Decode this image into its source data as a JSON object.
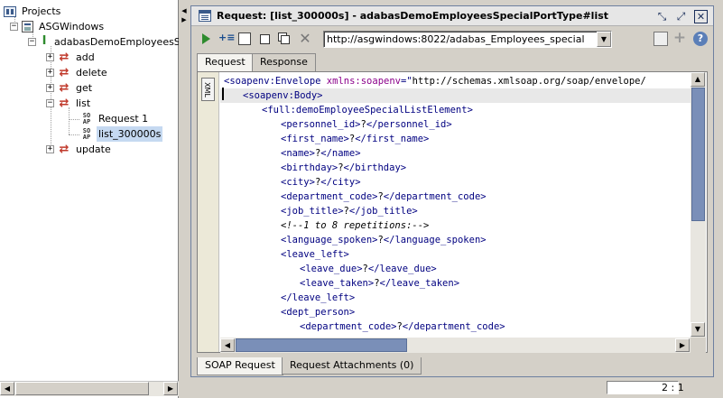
{
  "tree": {
    "root_label": "Projects",
    "project": "ASGWindows",
    "interface": "adabasDemoEmployeesSpe",
    "operations": [
      {
        "label": "add",
        "expanded": false
      },
      {
        "label": "delete",
        "expanded": false
      },
      {
        "label": "get",
        "expanded": false
      },
      {
        "label": "list",
        "expanded": true
      },
      {
        "label": "update",
        "expanded": false
      }
    ],
    "requests": [
      {
        "label": "Request 1",
        "selected": false
      },
      {
        "label": "list_300000s",
        "selected": true
      }
    ],
    "expander_plus": "+",
    "expander_minus": "−",
    "request_icon_text": "SO\nAP"
  },
  "window": {
    "title": "Request: [list_300000s] - adabasDemoEmployeesSpecialPortType#list",
    "restore_glyph": "⤡",
    "max_glyph": "⤢",
    "close_glyph": "✕"
  },
  "toolbar": {
    "endpoint_url": "http://asgwindows:8022/adabas_Employees_special",
    "add_glyph": "+≡",
    "cancel_glyph": "✕",
    "plus_glyph": "+",
    "help_glyph": "?"
  },
  "tabs": {
    "top": [
      "Request",
      "Response"
    ],
    "bottom": [
      "SOAP Request",
      "Request Attachments (0)"
    ]
  },
  "editor": {
    "side_label": "XML",
    "lines": [
      {
        "indent": 0,
        "parts": [
          [
            "t",
            "<soapenv:Envelope "
          ],
          [
            "a",
            "xmlns:soapenv"
          ],
          [
            "t",
            "=\""
          ],
          [
            "v",
            "http://schemas.xmlsoap.org/soap/envelope/"
          ]
        ]
      },
      {
        "indent": 1,
        "hl": true,
        "parts": [
          [
            "t",
            "<soapenv:Body>"
          ]
        ]
      },
      {
        "indent": 2,
        "parts": [
          [
            "t",
            "<full:demoEmployeeSpecialListElement>"
          ]
        ]
      },
      {
        "indent": 3,
        "parts": [
          [
            "t",
            "<personnel_id>"
          ],
          [
            "v",
            "?"
          ],
          [
            "t",
            "</personnel_id>"
          ]
        ]
      },
      {
        "indent": 3,
        "parts": [
          [
            "t",
            "<first_name>"
          ],
          [
            "v",
            "?"
          ],
          [
            "t",
            "</first_name>"
          ]
        ]
      },
      {
        "indent": 3,
        "parts": [
          [
            "t",
            "<name>"
          ],
          [
            "v",
            "?"
          ],
          [
            "t",
            "</name>"
          ]
        ]
      },
      {
        "indent": 3,
        "parts": [
          [
            "t",
            "<birthday>"
          ],
          [
            "v",
            "?"
          ],
          [
            "t",
            "</birthday>"
          ]
        ]
      },
      {
        "indent": 3,
        "parts": [
          [
            "t",
            "<city>"
          ],
          [
            "v",
            "?"
          ],
          [
            "t",
            "</city>"
          ]
        ]
      },
      {
        "indent": 3,
        "parts": [
          [
            "t",
            "<department_code>"
          ],
          [
            "v",
            "?"
          ],
          [
            "t",
            "</department_code>"
          ]
        ]
      },
      {
        "indent": 3,
        "parts": [
          [
            "t",
            "<job_title>"
          ],
          [
            "v",
            "?"
          ],
          [
            "t",
            "</job_title>"
          ]
        ]
      },
      {
        "indent": 3,
        "parts": [
          [
            "c",
            "<!--1 to 8 repetitions:-->"
          ]
        ]
      },
      {
        "indent": 3,
        "parts": [
          [
            "t",
            "<language_spoken>"
          ],
          [
            "v",
            "?"
          ],
          [
            "t",
            "</language_spoken>"
          ]
        ]
      },
      {
        "indent": 3,
        "parts": [
          [
            "t",
            "<leave_left>"
          ]
        ]
      },
      {
        "indent": 4,
        "parts": [
          [
            "t",
            "<leave_due>"
          ],
          [
            "v",
            "?"
          ],
          [
            "t",
            "</leave_due>"
          ]
        ]
      },
      {
        "indent": 4,
        "parts": [
          [
            "t",
            "<leave_taken>"
          ],
          [
            "v",
            "?"
          ],
          [
            "t",
            "</leave_taken>"
          ]
        ]
      },
      {
        "indent": 3,
        "parts": [
          [
            "t",
            "</leave_left>"
          ]
        ]
      },
      {
        "indent": 3,
        "parts": [
          [
            "t",
            "<dept_person>"
          ]
        ]
      },
      {
        "indent": 4,
        "parts": [
          [
            "t",
            "<department_code>"
          ],
          [
            "v",
            "?"
          ],
          [
            "t",
            "</department_code>"
          ]
        ]
      }
    ]
  },
  "status": {
    "cursor_position": "2 : 1"
  },
  "colors": {
    "tag": "#000080",
    "attribute": "#8b008b",
    "selection": "#c5d9f1",
    "scroll_thumb": "#7a8fb8"
  }
}
